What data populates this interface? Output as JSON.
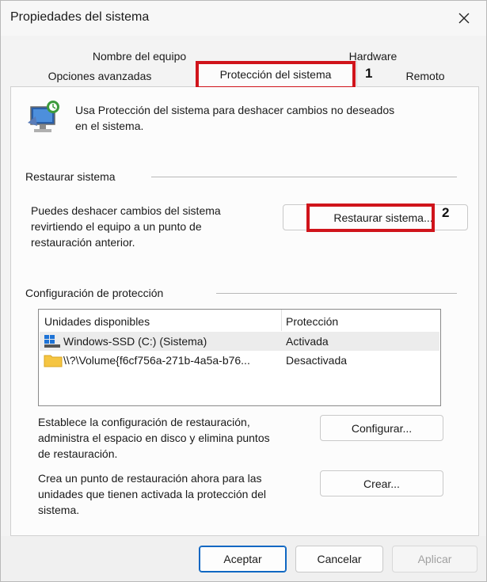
{
  "window": {
    "title": "Propiedades del sistema"
  },
  "tabs": {
    "row1": [
      "Nombre del equipo",
      "Hardware"
    ],
    "row2": [
      "Opciones avanzadas",
      "Protección del sistema",
      "Remoto"
    ],
    "active": "Protección del sistema"
  },
  "annotations": {
    "marker1": "1",
    "marker2": "2",
    "highlight_color": "#d0141b"
  },
  "intro": {
    "line1": "Usa Protección del sistema para deshacer cambios no deseados",
    "line2": "en el sistema."
  },
  "restore": {
    "group_label": "Restaurar sistema",
    "desc_line1": "Puedes deshacer cambios del sistema",
    "desc_line2": "revirtiendo el equipo a un punto de",
    "desc_line3": "restauración anterior.",
    "button": "Restaurar sistema..."
  },
  "protection": {
    "group_label": "Configuración de protección",
    "columns": [
      "Unidades disponibles",
      "Protección"
    ],
    "rows": [
      {
        "icon": "windows-drive-icon",
        "drive": "Windows-SSD (C:) (Sistema)",
        "status": "Activada"
      },
      {
        "icon": "folder-icon",
        "drive": "\\\\?\\Volume{f6cf756a-271b-4a5a-b76...",
        "status": "Desactivada"
      }
    ],
    "config_line1": "Establece la configuración de restauración,",
    "config_line2": "administra el espacio en disco y elimina puntos",
    "config_line3": "de restauración.",
    "config_button": "Configurar...",
    "create_line1": "Crea un punto de restauración ahora para las",
    "create_line2": "unidades que tienen activada la protección del",
    "create_line3": "sistema.",
    "create_button": "Crear..."
  },
  "footer": {
    "ok": "Aceptar",
    "cancel": "Cancelar",
    "apply": "Aplicar"
  },
  "colors": {
    "accent": "#0f67c2"
  }
}
